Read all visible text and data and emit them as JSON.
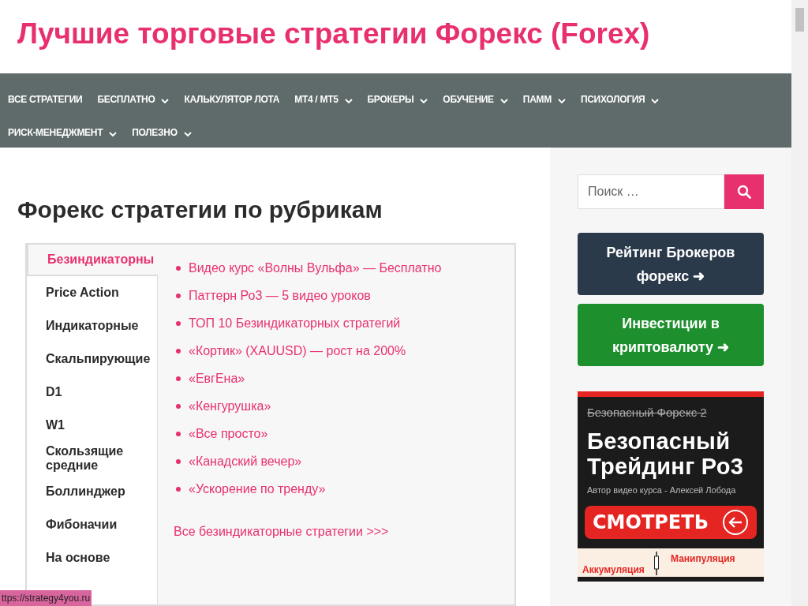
{
  "site_title": "Лучшие торговые стратегии Форекс (Forex)",
  "nav": [
    {
      "label": "ВСЕ СТРАТЕГИИ",
      "has_submenu": false
    },
    {
      "label": "БЕСПЛАТНО",
      "has_submenu": true
    },
    {
      "label": "КАЛЬКУЛЯТОР ЛОТА",
      "has_submenu": false
    },
    {
      "label": "MT4 / MT5",
      "has_submenu": true
    },
    {
      "label": "БРОКЕРЫ",
      "has_submenu": true
    },
    {
      "label": "ОБУЧЕНИЕ",
      "has_submenu": true
    },
    {
      "label": "ПАММ",
      "has_submenu": true
    },
    {
      "label": "ПСИХОЛОГИЯ",
      "has_submenu": true
    },
    {
      "label": "РИСК-МЕНЕДЖМЕНТ",
      "has_submenu": true
    },
    {
      "label": "ПОЛЕЗНО",
      "has_submenu": true
    }
  ],
  "heading": "Форекс стратегии по рубрикам",
  "tabs": [
    {
      "label": "Безиндикаторны",
      "selected": true
    },
    {
      "label": "Price Action",
      "selected": false
    },
    {
      "label": "Индикаторные",
      "selected": false
    },
    {
      "label": "Скальпирующие",
      "selected": false
    },
    {
      "label": "D1",
      "selected": false
    },
    {
      "label": "W1",
      "selected": false
    },
    {
      "label": "Скользящие средние",
      "selected": false
    },
    {
      "label": "Боллинджер",
      "selected": false
    },
    {
      "label": "Фибоначии",
      "selected": false
    },
    {
      "label": "На основе",
      "selected": false
    }
  ],
  "links": [
    "Видео курс «Волны Вульфа» — Бесплатно",
    "Паттерн Ро3 — 5 видео уроков",
    "ТОП 10 Безиндикаторных стратегий",
    "«Кортик» (XAUUSD) — рост на 200%",
    "«ЕвгЕна»",
    "«Кенгурушка»",
    "«Все просто»",
    "«Канадский вечер»",
    "«Ускорение по тренду»"
  ],
  "all_link": "Все безиндикаторные стратегии >>>",
  "sidebar": {
    "search": {
      "placeholder": "Поиск …"
    },
    "buttons": [
      {
        "label": "Рейтинг Брокеров форекс ➜",
        "color": "#2b3a4b"
      },
      {
        "label": "Инвестиции в криптовалюту ➜",
        "color": "#1d8f2d"
      }
    ],
    "banner": {
      "old_title": "Безопасный Форекс 2",
      "title": "Безопасный Трейдинг Ро3",
      "author": "Автор видео курса - Алексей Лобода",
      "cta": "СМОТРЕТЬ",
      "labels": [
        "Аккумуляция",
        "Манипуляция"
      ]
    }
  },
  "status_bar": "ttps://strategy4you.ru"
}
